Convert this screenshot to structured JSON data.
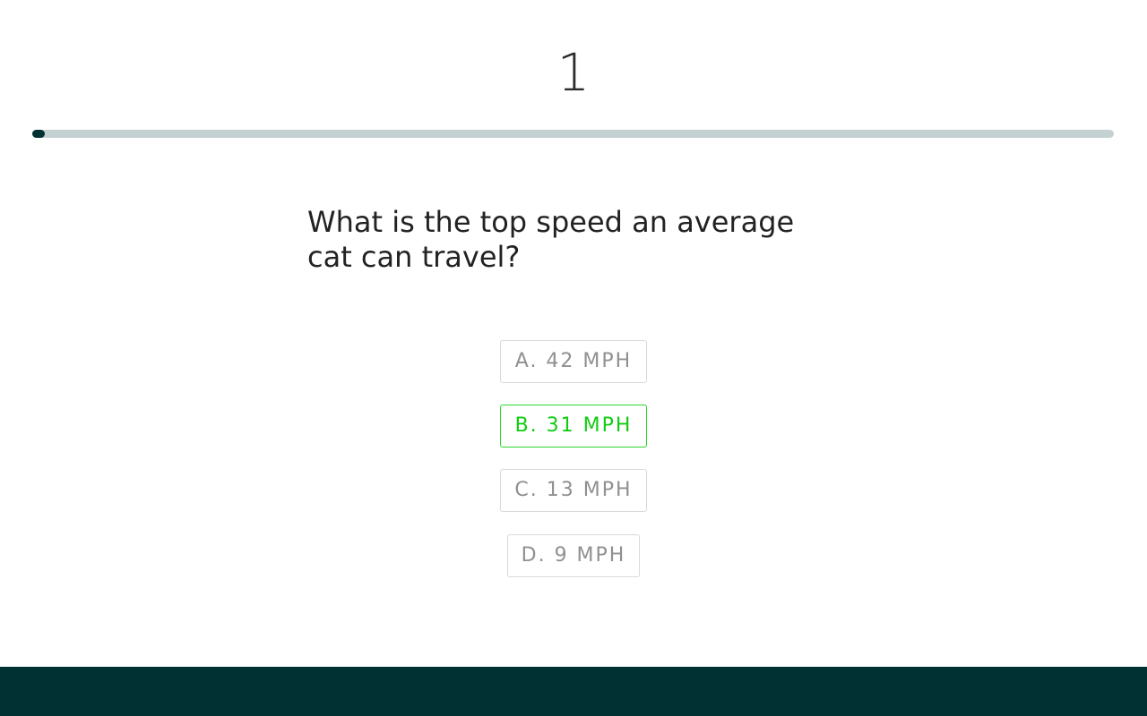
{
  "question": {
    "number": "1",
    "text": "What is the top speed an average cat can travel?",
    "progress_fraction": 0.011
  },
  "options": [
    {
      "label": "A. 42 MPH",
      "state": "default"
    },
    {
      "label": "B. 31 MPH",
      "state": "correct"
    },
    {
      "label": "C. 13 MPH",
      "state": "default"
    },
    {
      "label": "D. 9 MPH",
      "state": "default"
    }
  ],
  "colors": {
    "accent_dark": "#013133",
    "progress_track": "#c5d0d0",
    "correct_green": "#12cc12",
    "option_text": "#909090",
    "option_border": "#d9d9d9"
  }
}
